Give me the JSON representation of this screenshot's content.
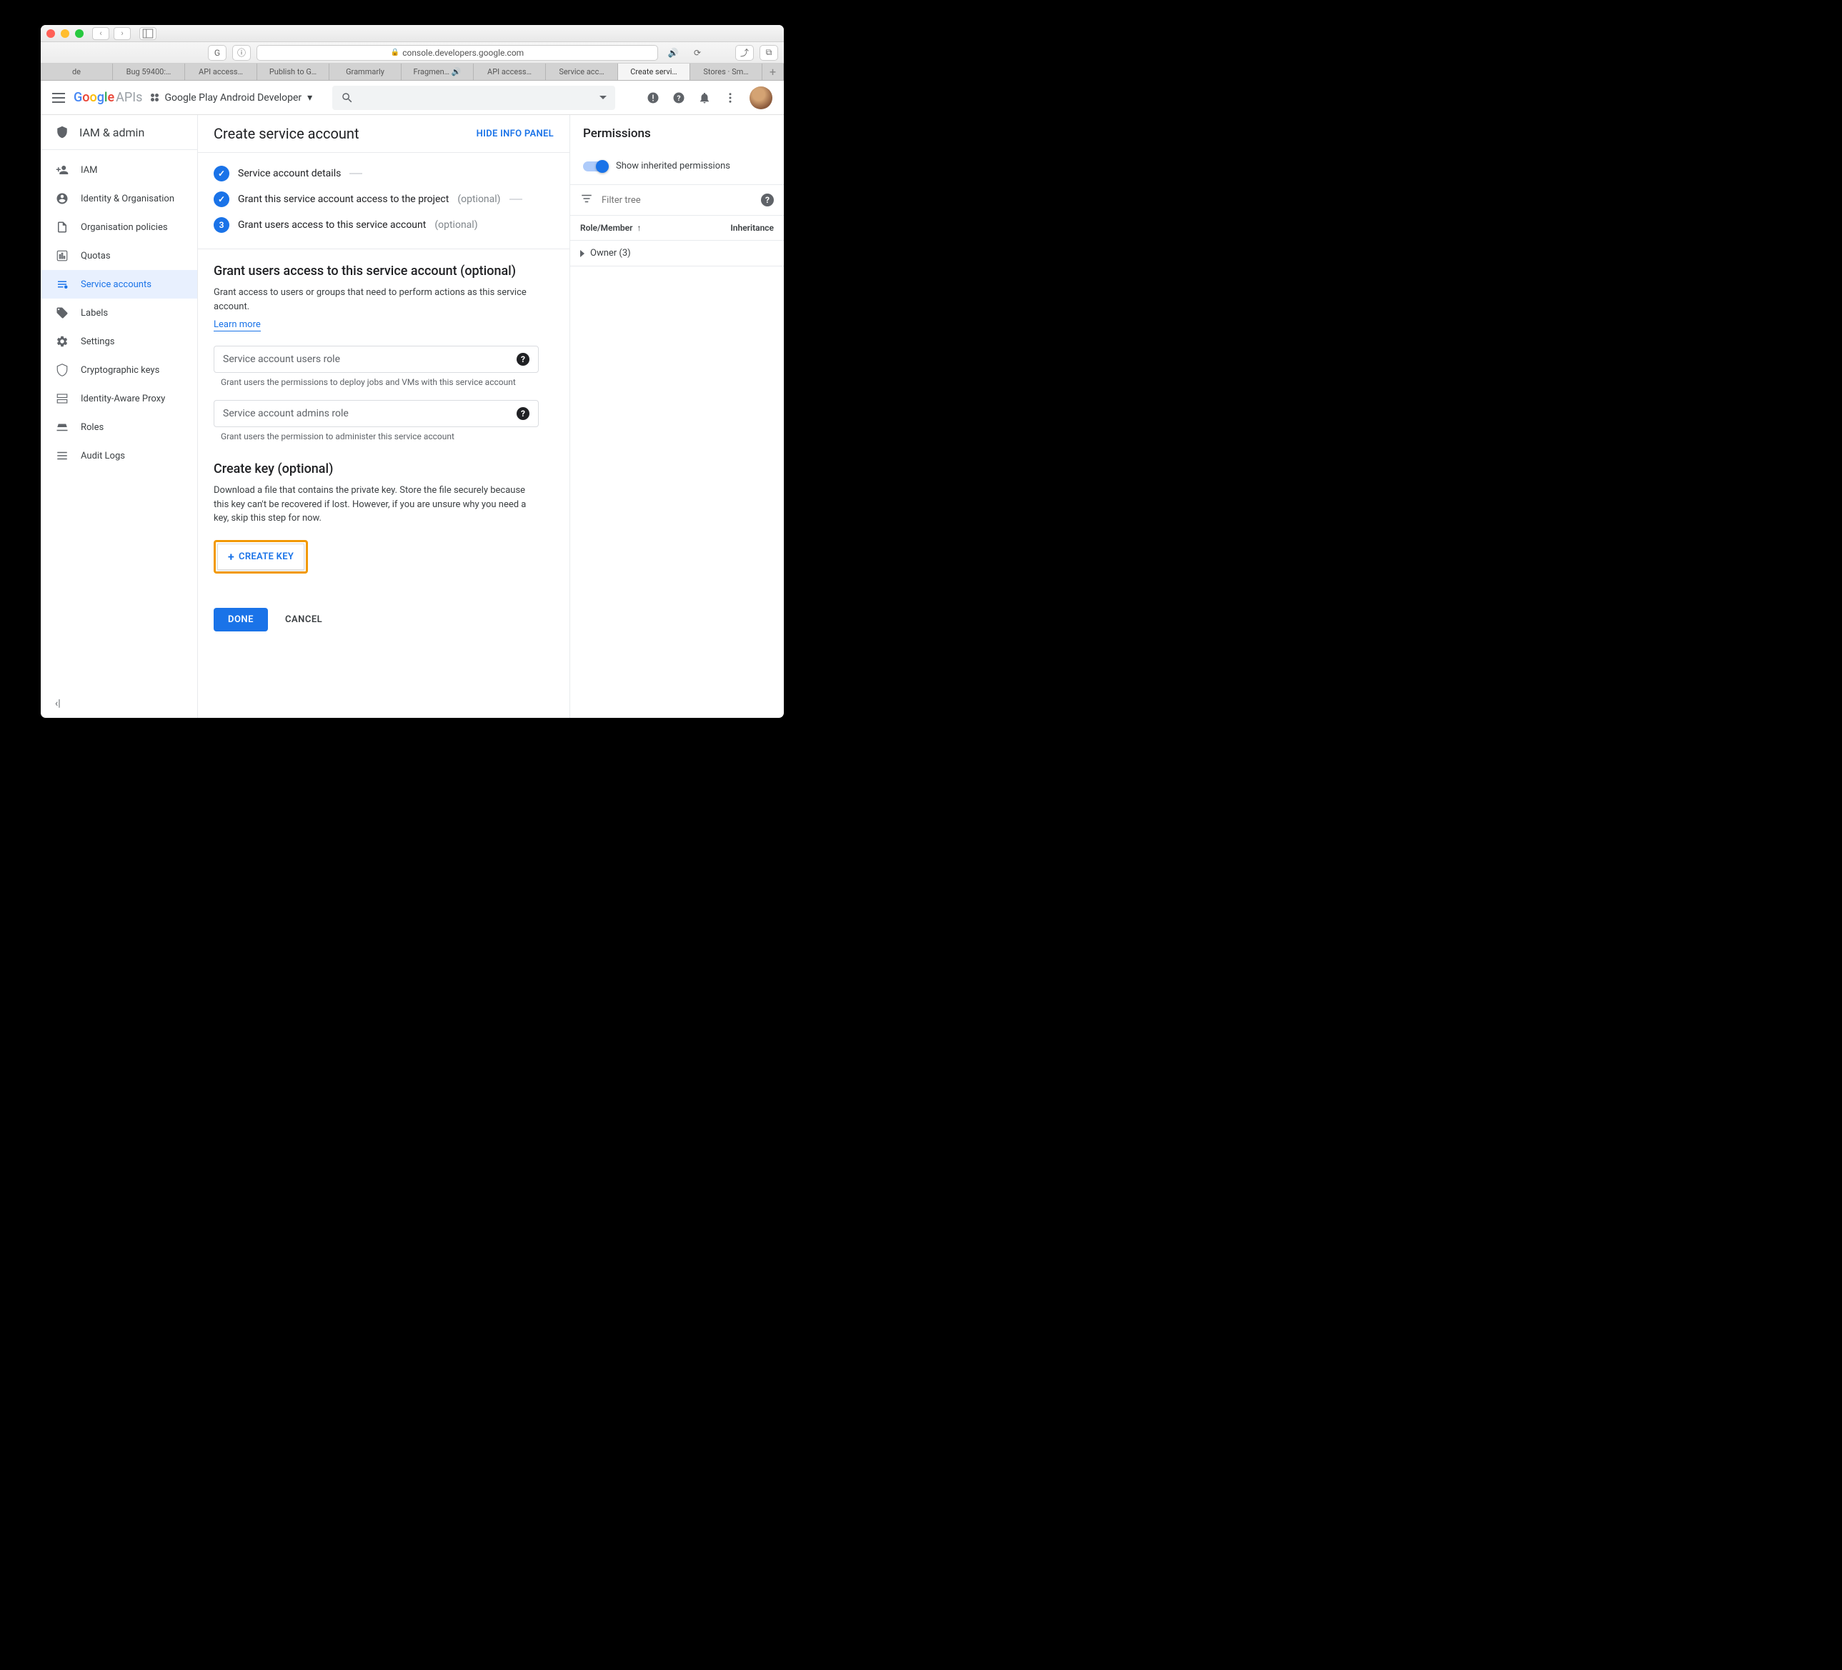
{
  "browser": {
    "url": "console.developers.google.com",
    "tabs": [
      "de",
      "Bug 59400:…",
      "API access…",
      "Publish to G…",
      "Grammarly",
      "Fragmen…",
      "API access…",
      "Service acc…",
      "Create servi…",
      "Stores · Sm…"
    ],
    "active_tab": 8
  },
  "header": {
    "logo_text": "Google",
    "logo_suffix": "APIs",
    "project": "Google Play Android Developer"
  },
  "sidebar": {
    "section": "IAM & admin",
    "items": [
      {
        "label": "IAM"
      },
      {
        "label": "Identity & Organisation"
      },
      {
        "label": "Organisation policies"
      },
      {
        "label": "Quotas"
      },
      {
        "label": "Service accounts",
        "active": true
      },
      {
        "label": "Labels"
      },
      {
        "label": "Settings"
      },
      {
        "label": "Cryptographic keys"
      },
      {
        "label": "Identity-Aware Proxy"
      },
      {
        "label": "Roles"
      },
      {
        "label": "Audit Logs"
      }
    ]
  },
  "page": {
    "title": "Create service account",
    "hide_panel": "HIDE INFO PANEL",
    "steps": [
      {
        "label": "Service account details",
        "done": true
      },
      {
        "label": "Grant this service account access to the project",
        "optional": "(optional)",
        "done": true
      },
      {
        "label": "Grant users access to this service account",
        "optional": "(optional)",
        "num": "3"
      }
    ],
    "grant_section": {
      "heading": "Grant users access to this service account (optional)",
      "desc": "Grant access to users or groups that need to perform actions as this service account.",
      "learn_more": "Learn more",
      "field1_label": "Service account users role",
      "field1_hint": "Grant users the permissions to deploy jobs and VMs with this service account",
      "field2_label": "Service account admins role",
      "field2_hint": "Grant users the permission to administer this service account"
    },
    "key_section": {
      "heading": "Create key (optional)",
      "desc": "Download a file that contains the private key. Store the file securely because this key can't be recovered if lost. However, if you are unsure why you need a key, skip this step for now.",
      "button": "CREATE KEY"
    },
    "done": "DONE",
    "cancel": "CANCEL"
  },
  "right_panel": {
    "title": "Permissions",
    "toggle_label": "Show inherited permissions",
    "filter_placeholder": "Filter tree",
    "col_role": "Role/Member",
    "col_inh": "Inheritance",
    "row_owner": "Owner (3)"
  }
}
